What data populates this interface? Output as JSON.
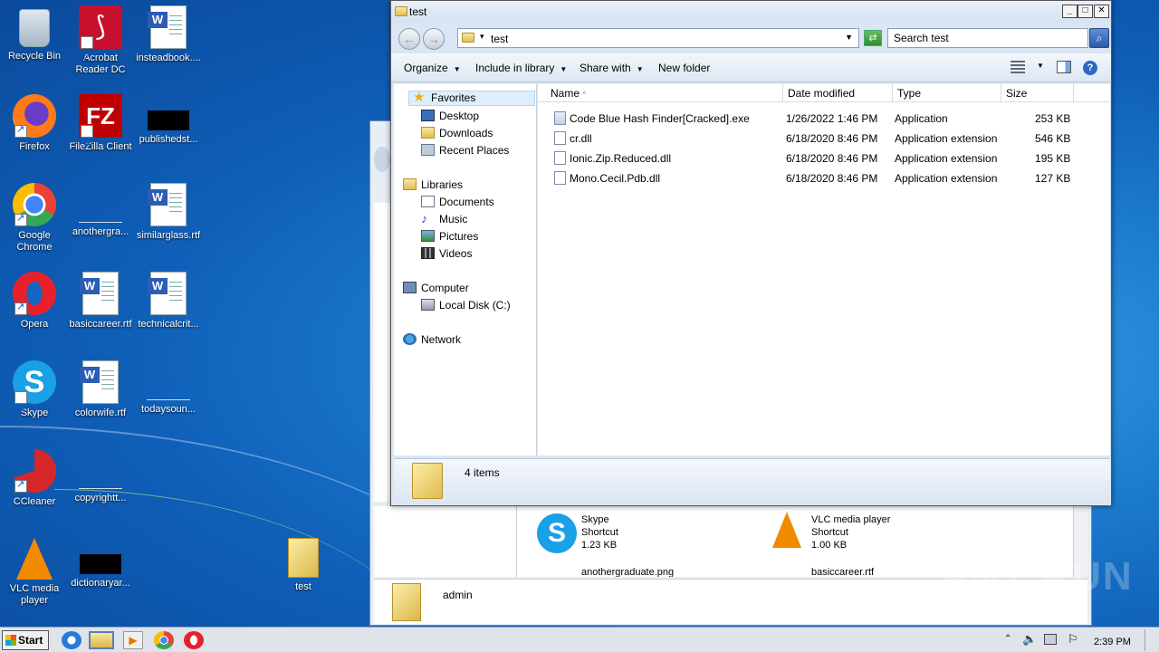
{
  "desktop": {
    "icons": [
      {
        "label": "Recycle Bin",
        "icon": "recycle-bin-icon"
      },
      {
        "label": "Acrobat\nReader DC",
        "icon": "acrobat-icon"
      },
      {
        "label": "insteadbook....",
        "icon": "word-doc-icon"
      },
      {
        "label": "Firefox",
        "icon": "firefox-icon"
      },
      {
        "label": "FileZilla Client",
        "icon": "filezilla-icon"
      },
      {
        "label": "publishedst...",
        "icon": "black-thumbnail-icon"
      },
      {
        "label": "Google\nChrome",
        "icon": "chrome-icon"
      },
      {
        "label": "anothergra...",
        "icon": "blank-image-icon"
      },
      {
        "label": "similarglass.rtf",
        "icon": "word-doc-icon"
      },
      {
        "label": "Opera",
        "icon": "opera-icon"
      },
      {
        "label": "basiccareer.rtf",
        "icon": "word-doc-icon"
      },
      {
        "label": "technicalcrit...",
        "icon": "word-doc-icon"
      },
      {
        "label": "Skype",
        "icon": "skype-icon"
      },
      {
        "label": "colorwife.rtf",
        "icon": "word-doc-icon"
      },
      {
        "label": "todaysoun...",
        "icon": "blank-image-icon"
      },
      {
        "label": "CCleaner",
        "icon": "ccleaner-icon"
      },
      {
        "label": "copyrightt...",
        "icon": "blank-image-icon"
      },
      {
        "label": "VLC media\nplayer",
        "icon": "vlc-icon"
      },
      {
        "label": "dictionaryar...",
        "icon": "black-thumbnail-icon"
      },
      {
        "label": "test",
        "icon": "folder-icon"
      }
    ]
  },
  "window": {
    "title": "test",
    "address": "test",
    "search_placeholder": "Search test",
    "toolbar": {
      "organize": "Organize",
      "include_in_library": "Include in library",
      "share_with": "Share with",
      "new_folder": "New folder"
    },
    "nav": {
      "favorites": "Favorites",
      "desktop": "Desktop",
      "downloads": "Downloads",
      "recent_places": "Recent Places",
      "libraries": "Libraries",
      "documents": "Documents",
      "music": "Music",
      "pictures": "Pictures",
      "videos": "Videos",
      "computer": "Computer",
      "local_disk": "Local Disk (C:)",
      "network": "Network"
    },
    "columns": {
      "name": "Name",
      "date": "Date modified",
      "type": "Type",
      "size": "Size"
    },
    "files": [
      {
        "name": "Code Blue Hash Finder[Cracked].exe",
        "date": "1/26/2022 1:46 PM",
        "type": "Application",
        "size": "253 KB"
      },
      {
        "name": "cr.dll",
        "date": "6/18/2020 8:46 PM",
        "type": "Application extension",
        "size": "546 KB"
      },
      {
        "name": "Ionic.Zip.Reduced.dll",
        "date": "6/18/2020 8:46 PM",
        "type": "Application extension",
        "size": "195 KB"
      },
      {
        "name": "Mono.Cecil.Pdb.dll",
        "date": "6/18/2020 8:46 PM",
        "type": "Application extension",
        "size": "127 KB"
      }
    ],
    "status": "4 items"
  },
  "back_window": {
    "items": [
      {
        "name": "Skype",
        "kind": "Shortcut",
        "size": "1.23 KB"
      },
      {
        "name": "VLC media player",
        "kind": "Shortcut",
        "size": "1.00 KB"
      },
      {
        "name": "anothergraduate.png"
      },
      {
        "name": "basiccareer.rtf"
      }
    ],
    "detail_user": "admin"
  },
  "taskbar": {
    "start": "Start",
    "clock": "2:39 PM"
  },
  "watermark": "ANY RUN"
}
